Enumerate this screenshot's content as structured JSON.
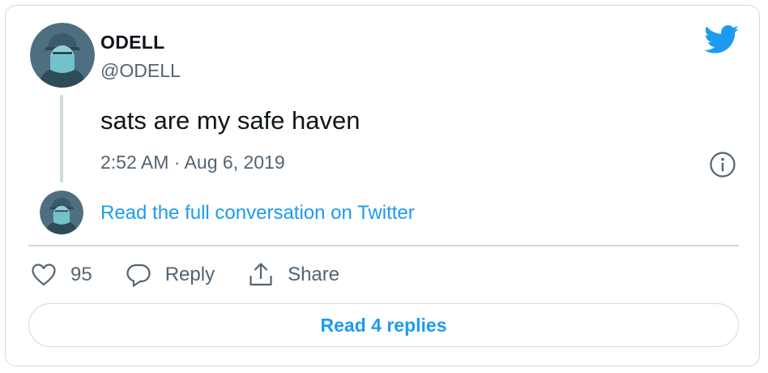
{
  "tweet": {
    "display_name": "ODELL",
    "handle": "@ODELL",
    "text": "sats are my safe haven",
    "timestamp": "2:52 AM · Aug 6, 2019"
  },
  "conversation": {
    "link_label": "Read the full conversation on Twitter"
  },
  "actions": {
    "like_count": "95",
    "reply_label": "Reply",
    "share_label": "Share"
  },
  "replies_button": {
    "label": "Read 4 replies"
  },
  "icons": {
    "brand": "twitter-bird-icon",
    "info": "info-icon",
    "like": "heart-icon",
    "reply": "speech-bubble-icon",
    "share": "share-arrow-icon"
  },
  "colors": {
    "accent": "#1d9bf0",
    "text_primary": "#0f1419",
    "text_secondary": "#536471",
    "border": "#cfd9de",
    "avatar_bg": "#4a6b7c",
    "avatar_face": "#8fd3d8"
  }
}
